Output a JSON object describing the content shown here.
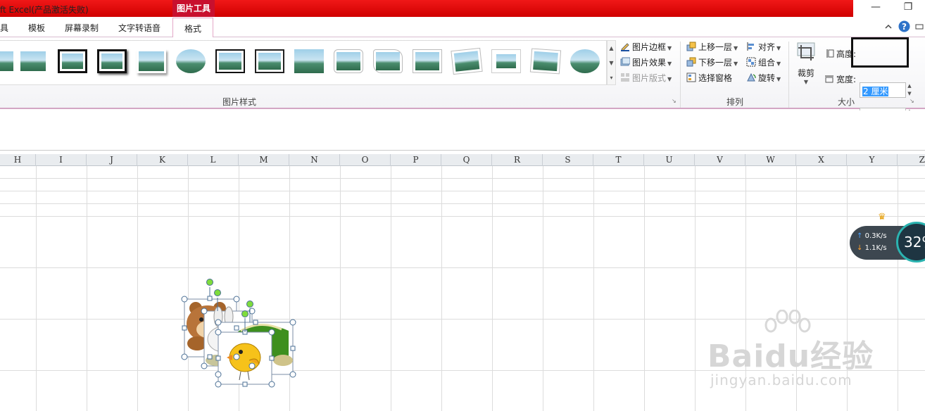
{
  "window": {
    "title": "ft Excel(产品激活失败)",
    "context_tab": "图片工具",
    "minimize_glyph": "—",
    "restore_glyph": "❐"
  },
  "tabs": [
    "具",
    "模板",
    "屏幕录制",
    "文字转语音",
    "格式"
  ],
  "tab_right_icons": [
    "collapse-ribbon-icon",
    "help-icon",
    "minimize-ribbon-icon"
  ],
  "ribbon": {
    "picture_styles_label": "图片样式",
    "picture_border": "图片边框",
    "picture_effects": "图片效果",
    "picture_layout": "图片版式",
    "arrange_label": "排列",
    "bring_forward": "上移一层",
    "send_backward": "下移一层",
    "selection_pane": "选择窗格",
    "align": "对齐",
    "group": "组合",
    "rotate": "旋转",
    "crop": "裁剪",
    "size_label": "大小",
    "height_label": "高度:",
    "height_value": "2 厘米",
    "width_label": "宽度:",
    "width_value": ""
  },
  "columns": [
    "H",
    "I",
    "J",
    "K",
    "L",
    "M",
    "N",
    "O",
    "P",
    "Q",
    "R",
    "S",
    "T",
    "U",
    "V",
    "W",
    "X",
    "Y",
    "Z"
  ],
  "net_widget": {
    "upload": "0.3K/s",
    "download": "1.1K/s",
    "percent": "32%"
  },
  "watermark": {
    "logo": "Baidu经验",
    "url": "jingyan.baidu.com"
  }
}
